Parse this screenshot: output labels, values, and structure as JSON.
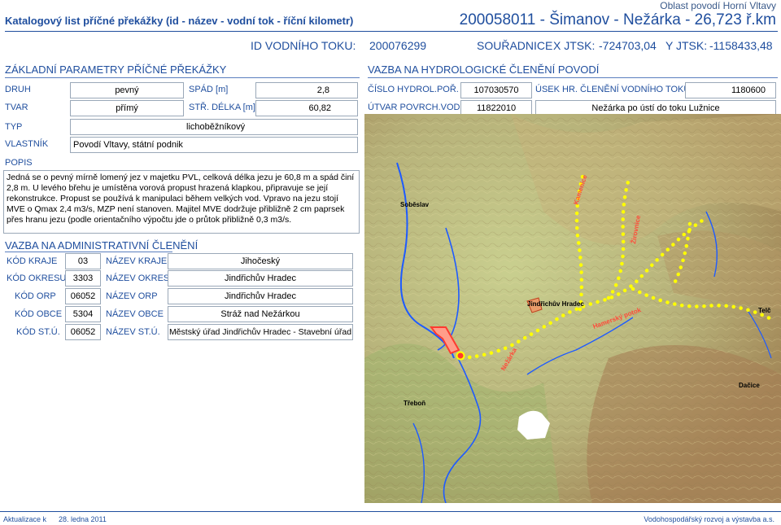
{
  "header": {
    "title": "Katalogový list příčné překážky (id - název - vodní tok - říční kilometr)",
    "region": "Oblast povodí Horní Vltavy",
    "id_line": "200058011 - Šimanov - Nežárka - 26,723 ř.km",
    "watercourse_id_label": "ID VODNÍHO TOKU:",
    "watercourse_id": "200076299",
    "coords_label": "SOUŘADNICE",
    "x_label": "X JTSK:",
    "x_value": "-724703,04",
    "y_label": "Y JTSK:",
    "y_value": "-1158433,48"
  },
  "basic": {
    "heading": "ZÁKLADNÍ PARAMETRY PŘÍČNÉ PŘEKÁŽKY",
    "druh_label": "DRUH",
    "druh_value": "pevný",
    "spad_label": "SPÁD [m]",
    "spad_value": "2,8",
    "tvar_label": "TVAR",
    "tvar_value": "přímý",
    "delka_label": "STŘ. DÉLKA [m]",
    "delka_value": "60,82",
    "typ_label": "TYP",
    "typ_value": "lichoběžníkový",
    "vlastnik_label": "VLASTNÍK",
    "vlastnik_value": "Povodí Vltavy, státní podnik",
    "popis_label": "POPIS",
    "popis_text": "Jedná se o pevný mírně lomený jez v majetku PVL, celková délka jezu je 60,8 m a spád činí 2,8 m. U levého břehu je umístěna vorová propust hrazená klapkou, připravuje se její rekonstrukce. Propust se používá k manipulaci během velkých vod. Vpravo na jezu stojí MVE o Qmax 2,4 m3/s, MZP není stanoven. Majitel MVE dodržuje přibližně 2 cm paprsek přes hranu jezu (podle orientačního výpočtu jde o průtok přibližně 0,3 m3/s."
  },
  "hydro": {
    "heading": "VAZBA NA HYDROLOGICKÉ ČLENĚNÍ POVODÍ",
    "cislo_label": "ČÍSLO HYDROL.POŘ.",
    "cislo_value": "107030570",
    "usek_label": "ÚSEK HR. ČLENĚNÍ VODNÍHO TOKU",
    "usek_value": "1180600",
    "utvar_label": "ÚTVAR POVRCH.VOD",
    "utvar_value": "11822010",
    "utvar_name": "Nežárka po ústí do toku Lužnice"
  },
  "admin": {
    "heading": "VAZBA NA ADMINISTRATIVNÍ ČLENĚNÍ",
    "rows": [
      {
        "code_label": "KÓD KRAJE",
        "code": "03",
        "name_label": "NÁZEV KRAJE",
        "name": "Jihočeský"
      },
      {
        "code_label": "KÓD OKRESU",
        "code": "3303",
        "name_label": "NÁZEV OKRESU",
        "name": "Jindřichův Hradec"
      },
      {
        "code_label": "KÓD ORP",
        "code": "06052",
        "name_label": "NÁZEV ORP",
        "name": "Jindřichův Hradec"
      },
      {
        "code_label": "KÓD OBCE",
        "code": "5304",
        "name_label": "NÁZEV OBCE",
        "name": "Stráž nad Nežárkou"
      },
      {
        "code_label": "KÓD ST.Ú.",
        "code": "06052",
        "name_label": "NÁZEV ST.Ú.",
        "name": "Městský úřad Jindřichův Hradec - Stavební úřad"
      }
    ]
  },
  "map": {
    "labels": {
      "sobeslav": "Soběslav",
      "kamenice": "Kamenice",
      "zirovnice": "Žirovnice",
      "jindrichuv": "Jindřichův Hradec",
      "hamersky": "Hamerský potok",
      "telc": "Telč",
      "nezarka": "Nežárka",
      "dacice": "Dačice",
      "trebon": "Třeboň"
    },
    "colors": {
      "river": "#1e5bff",
      "point": "#ffff00",
      "marker": "#ff3b30"
    }
  },
  "footer": {
    "update_label": "Aktualizace k",
    "update_date": "28. ledna 2011",
    "author": "Vodohospodářský rozvoj a výstavba a.s."
  }
}
